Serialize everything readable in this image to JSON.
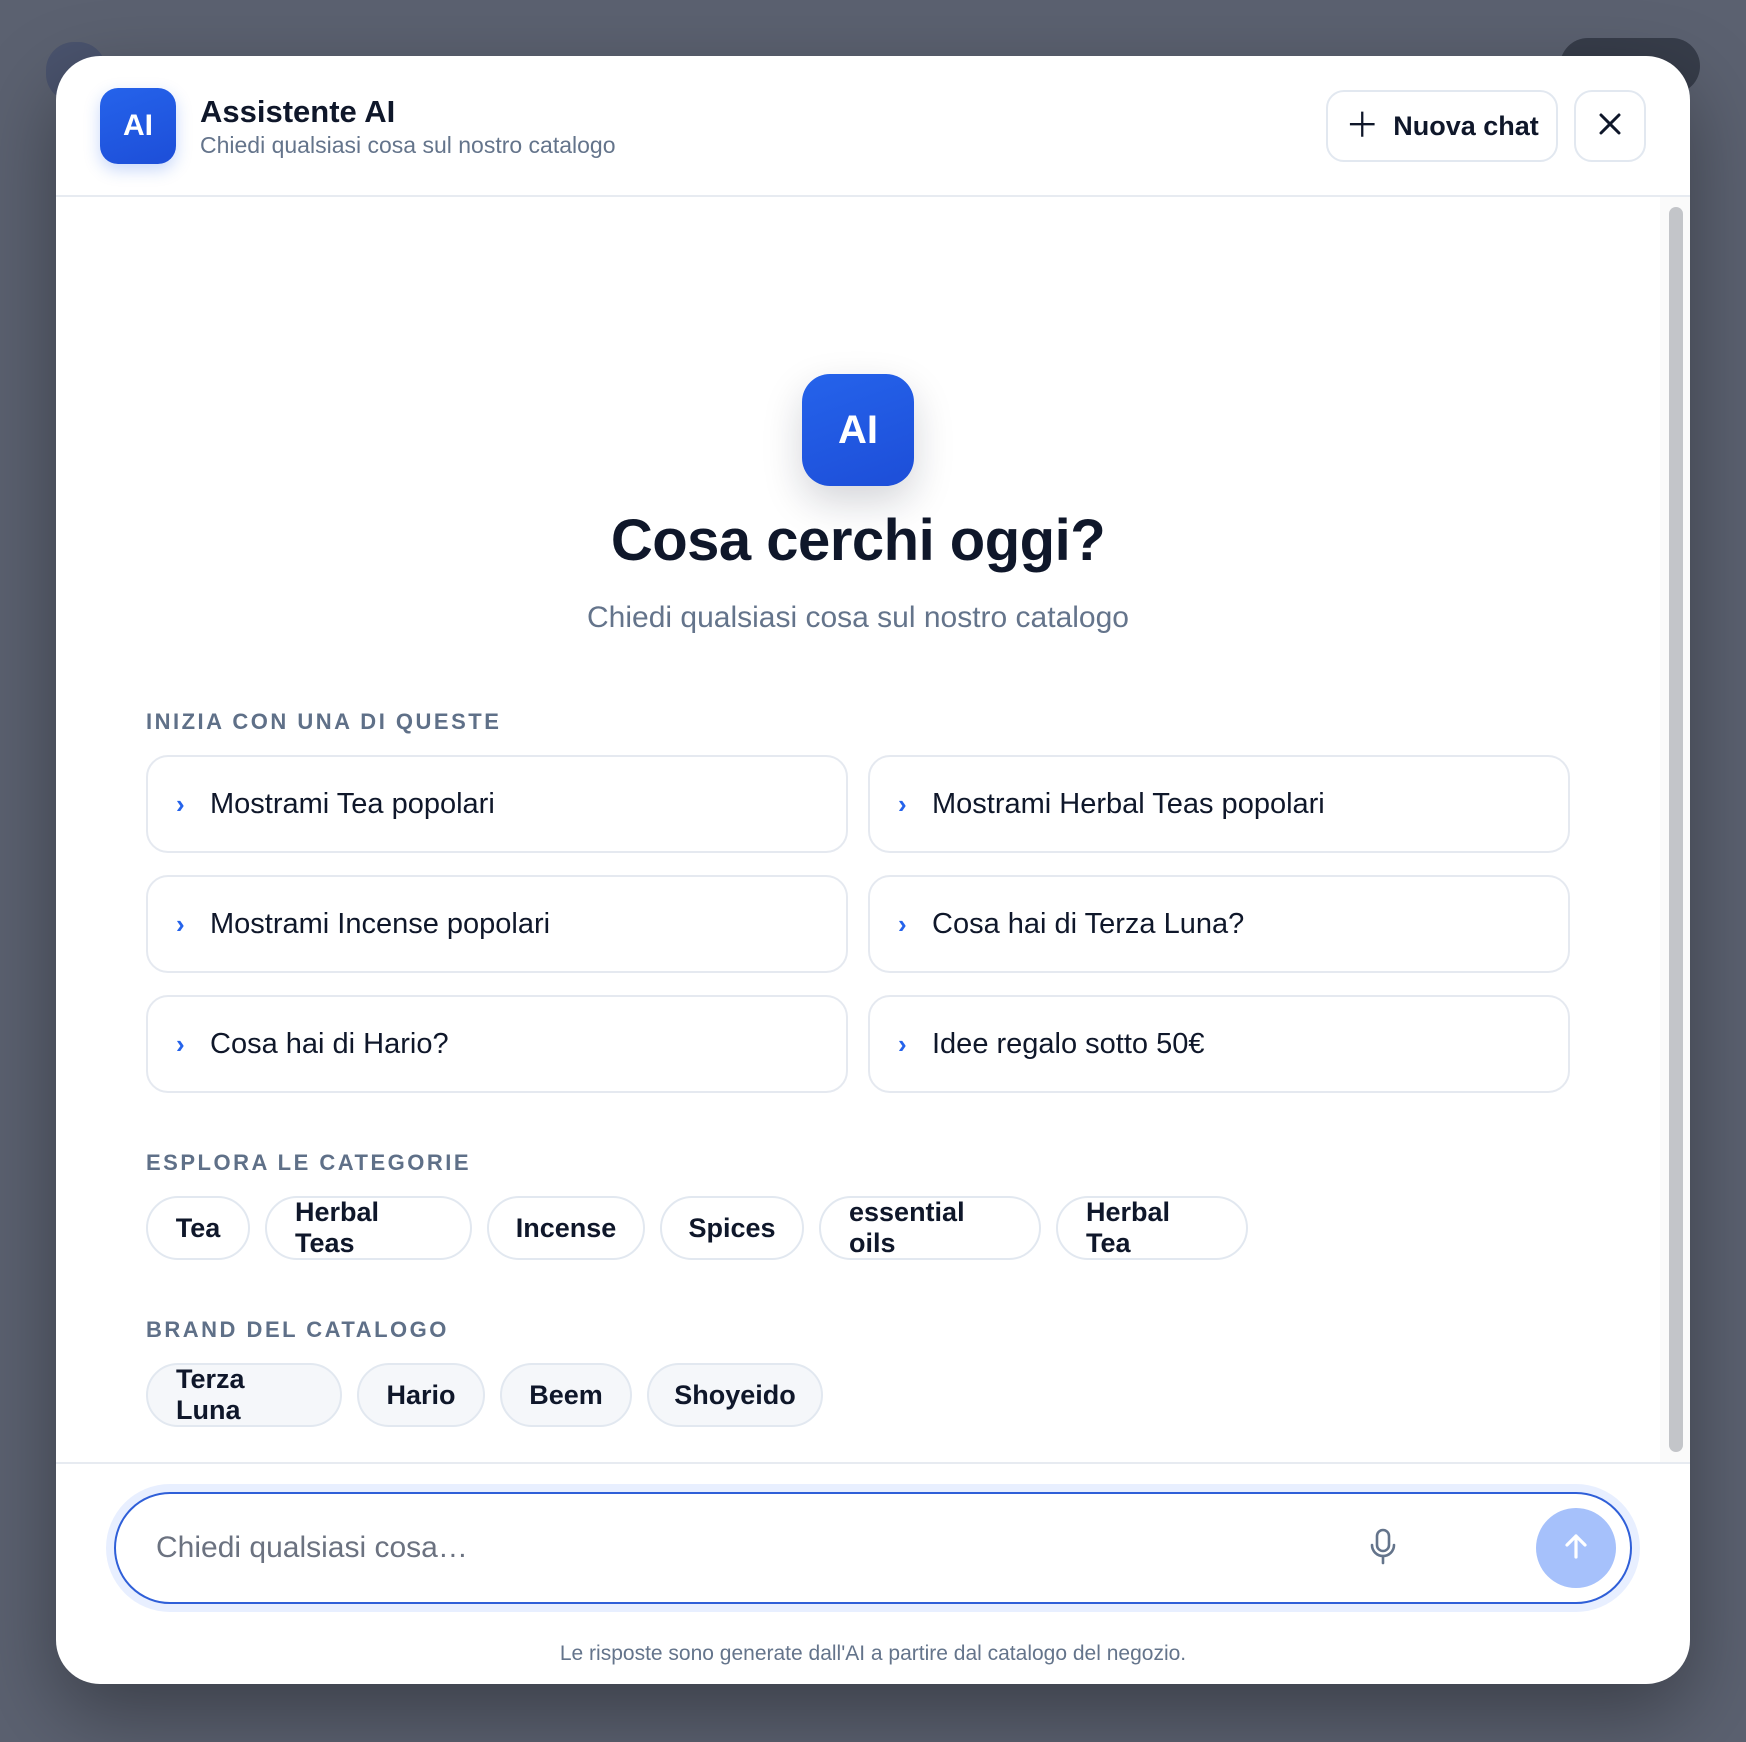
{
  "header": {
    "logo": "AI",
    "title": "Assistente AI",
    "subtitle": "Chiedi qualsiasi cosa sul nostro catalogo",
    "new_chat_label": "Nuova chat",
    "new_chat_icon": "plus-icon",
    "close_icon": "close-icon"
  },
  "hero": {
    "badge": "AI",
    "title": "Cosa cerchi oggi?",
    "subtitle": "Chiedi qualsiasi cosa sul nostro catalogo"
  },
  "suggestions": {
    "label": "INIZIA CON UNA DI QUESTE",
    "items": [
      "Mostrami Tea popolari",
      "Mostrami Herbal Teas popolari",
      "Mostrami Incense popolari",
      "Cosa hai di Terza Luna?",
      "Cosa hai di Hario?",
      "Idee regalo sotto 50€"
    ]
  },
  "categories": {
    "label": "ESPLORA LE CATEGORIE",
    "items": [
      "Tea",
      "Herbal Teas",
      "Incense",
      "Spices",
      "essential oils",
      "Herbal Tea"
    ]
  },
  "brands": {
    "label": "BRAND DEL CATALOGO",
    "items": [
      "Terza Luna",
      "Hario",
      "Beem",
      "Shoyeido"
    ]
  },
  "composer": {
    "placeholder": "Chiedi qualsiasi cosa…",
    "value": "",
    "mic_icon": "microphone-icon",
    "send_icon": "arrow-up-icon",
    "disclaimer": "Le risposte sono generate dall'AI a partire dal catalogo del negozio."
  },
  "colors": {
    "accent": "#2563eb",
    "send_disabled": "#a6c1fb",
    "muted_text": "#64748b"
  }
}
